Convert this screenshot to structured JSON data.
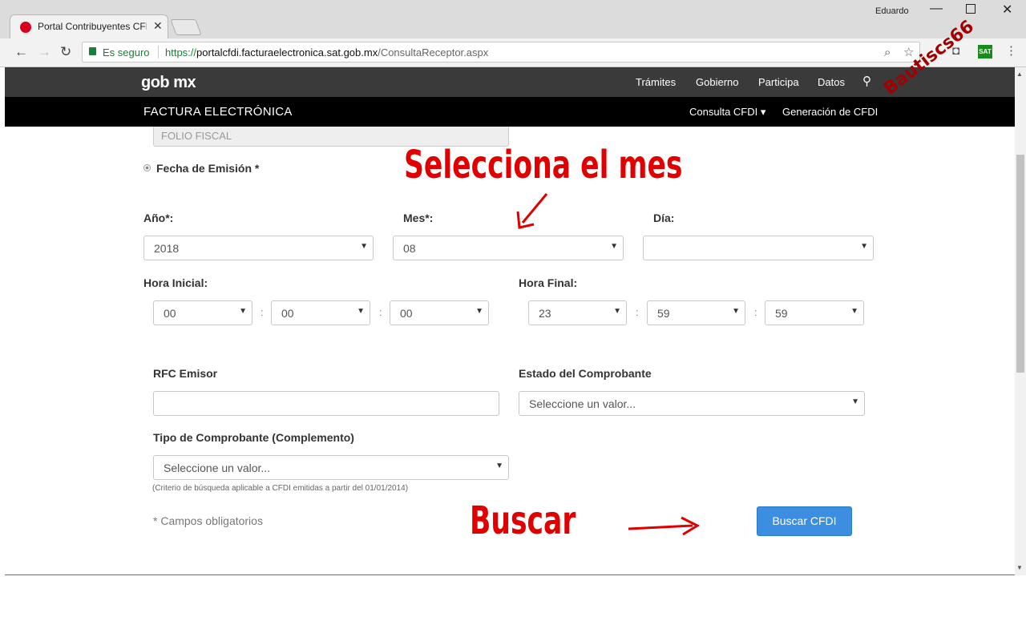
{
  "browser": {
    "tab_title": "Portal Contribuyentes CFDI",
    "user_name": "Eduardo",
    "secure_label": "Es seguro",
    "url_protocol": "https://",
    "url_host": "portalcfdi.facturaelectronica.sat.gob.mx",
    "url_path": "/ConsultaReceptor.aspx",
    "extension_label": "SAT"
  },
  "gob_nav": {
    "logo": "gob mx",
    "links": [
      "Trámites",
      "Gobierno",
      "Participa",
      "Datos"
    ]
  },
  "factura_nav": {
    "title": "FACTURA ELECTRÓNICA",
    "links": [
      "Consulta CFDI ▾",
      "Generación de CFDI"
    ]
  },
  "form": {
    "folio_placeholder": "FOLIO FISCAL",
    "fecha_label": "Fecha de Emisión *",
    "anio_label": "Año*:",
    "anio_value": "2018",
    "mes_label": "Mes*:",
    "mes_value": "08",
    "dia_label": "Día:",
    "dia_value": "",
    "hora_inicial_label": "Hora Inicial:",
    "hora_inicial": [
      "00",
      "00",
      "00"
    ],
    "hora_final_label": "Hora Final:",
    "hora_final": [
      "23",
      "59",
      "59"
    ],
    "rfc_label": "RFC Emisor",
    "rfc_value": "",
    "estado_label": "Estado del Comprobante",
    "estado_value": "Seleccione un valor...",
    "tipo_label": "Tipo de Comprobante (Complemento)",
    "tipo_value": "Seleccione un valor...",
    "criterio_note": "(Criterio de búsqueda aplicable a CFDI emitidas a partir del 01/01/2014)",
    "campos_note": "* Campos obligatorios",
    "buscar_button": "Buscar CFDI"
  },
  "annotations": {
    "mes_text": "Selecciona el mes",
    "buscar_text": "Buscar",
    "watermark": "Bautiscs66"
  },
  "colors": {
    "annotation": "#e00000",
    "button": "#3b8ee0",
    "gob_bar": "#3a3a3a",
    "factura_bar": "#000000"
  }
}
